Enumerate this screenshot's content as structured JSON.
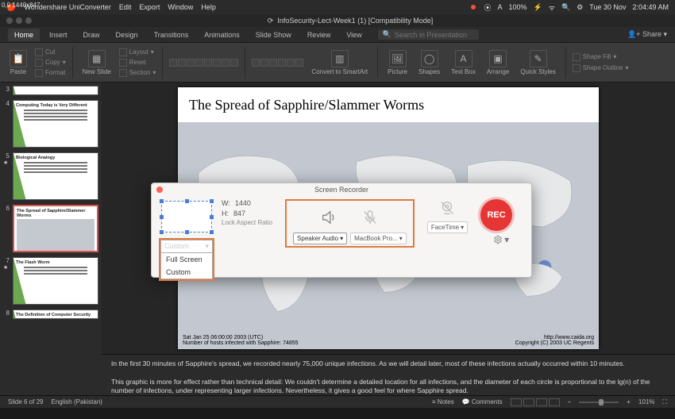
{
  "overlay_dimensions": "0,0 1440x847",
  "mac_menu": {
    "app": "Wondershare UniConverter",
    "items": [
      "Edit",
      "Export",
      "Window",
      "Help"
    ],
    "battery": "100%",
    "battery_status": "⚡",
    "date": "Tue 30 Nov",
    "time": "2:04:49 AM"
  },
  "window": {
    "title": "InfoSecurity-Lect-Week1 (1) [Compatibility Mode]",
    "share_label": "Share",
    "search_placeholder": "Search in Presentation"
  },
  "ribbon": {
    "tabs": [
      "Home",
      "Insert",
      "Draw",
      "Design",
      "Transitions",
      "Animations",
      "Slide Show",
      "Review",
      "View"
    ],
    "active_tab": "Home",
    "paste_label": "Paste",
    "cut_label": "Cut",
    "copy_label": "Copy",
    "format_label": "Format",
    "new_slide_label": "New Slide",
    "layout_label": "Layout",
    "reset_label": "Reset",
    "section_label": "Section",
    "convert_label": "Convert to SmartArt",
    "picture_label": "Picture",
    "shapes_label": "Shapes",
    "textbox_label": "Text Box",
    "arrange_label": "Arrange",
    "quickstyles_label": "Quick Styles",
    "shapefill_label": "Shape Fill",
    "shapeoutline_label": "Shape Outline"
  },
  "thumbnails": {
    "items": [
      {
        "num": "3",
        "title": ""
      },
      {
        "num": "4",
        "title": "Computing Today is Very Different",
        "starred": false
      },
      {
        "num": "5",
        "title": "Biological Analogy",
        "starred": true
      },
      {
        "num": "6",
        "title": "The Spread of Sapphire/Slammer Worms",
        "active": true,
        "map": true
      },
      {
        "num": "7",
        "title": "The Flash Worm",
        "starred": true
      },
      {
        "num": "8",
        "title": "The Definition of Computer Security"
      }
    ]
  },
  "slide": {
    "title": "The Spread of Sapphire/Slammer Worms",
    "timestamp": "Sat Jan 25 06:00:00 2003 (UTC)",
    "infected_line": "Number of hosts infected with Sapphire: 74855",
    "url": "http://www.caida.org",
    "copyright": "Copyright (C) 2003 UC Regents"
  },
  "notes": {
    "p1": "In the first 30 minutes of Sapphire's spread, we recorded nearly 75,000 unique infections.  As we will detail later, most of these infections actually occurred within 10 minutes.",
    "p2": "This graphic is more for effect rather than technical detail: We couldn't determine a detailed location for all infections, and the diameter of each circle is proportional to the lg(n) of the number of infections, under representing larger infections.  Nevertheless, it gives a good feel for where Sapphire spread."
  },
  "statusbar": {
    "slide_count": "Slide 6 of 29",
    "language": "English (Pakistan)",
    "notes_label": "Notes",
    "comments_label": "Comments",
    "zoom": "101%"
  },
  "recorder": {
    "title": "Screen Recorder",
    "w_label": "W:",
    "h_label": "H:",
    "w_value": "1440",
    "h_value": "847",
    "lock_aspect": "Lock Aspect Ratio",
    "size_mode": "Custom",
    "size_options": [
      "Full Screen",
      "Custom"
    ],
    "speaker_dd": "Speaker Audio",
    "mic_dd": "MacBook Pro...",
    "webcam_dd": "FaceTime",
    "rec_label": "REC"
  }
}
